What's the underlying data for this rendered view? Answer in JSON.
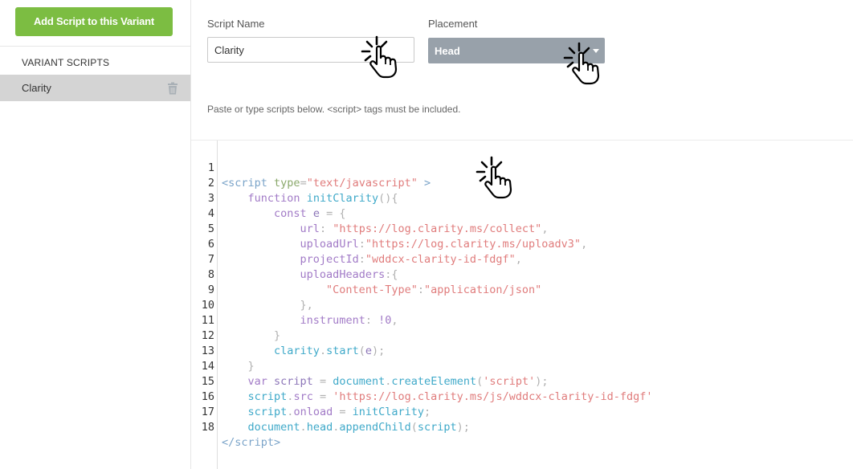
{
  "sidebar": {
    "add_button_label": "Add Script to this Variant",
    "section_heading": "VARIANT SCRIPTS",
    "items": [
      {
        "label": "Clarity"
      }
    ]
  },
  "form": {
    "script_name_label": "Script Name",
    "script_name_value": "Clarity",
    "placement_label": "Placement",
    "placement_value": "Head",
    "hint": "Paste or type scripts below. <script> tags must be included."
  },
  "editor": {
    "line_numbers": [
      "1",
      "2",
      "3",
      "4",
      "5",
      "6",
      "7",
      "8",
      "9",
      "10",
      "11",
      "12",
      "13",
      "14",
      "15",
      "16",
      "17",
      "18"
    ]
  },
  "colors": {
    "primary_button": "#7cbd42",
    "select_bg": "#98a1aa",
    "selected_item_bg": "#d4d4d4"
  },
  "icons": {
    "trash": "trash-icon",
    "caret": "chevron-down-icon",
    "cursor": "pointer-hand-icon"
  }
}
